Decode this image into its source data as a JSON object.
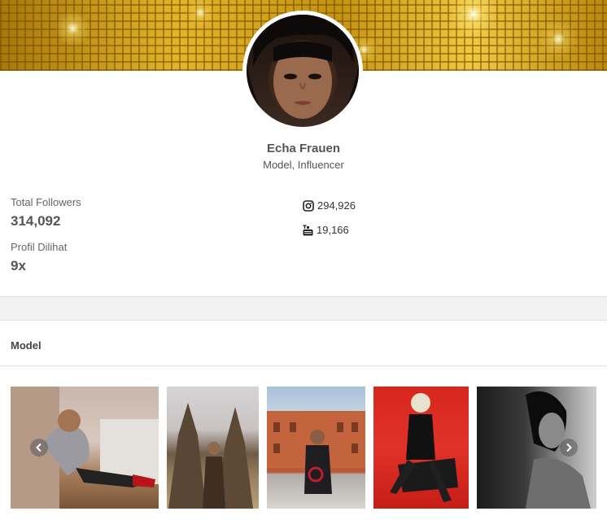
{
  "profile": {
    "name": "Echa Frauen",
    "subtitle": "Model, Influencer"
  },
  "stats": {
    "total_followers_label": "Total Followers",
    "total_followers_value": "314,092",
    "profile_views_label": "Profil Dilihat",
    "profile_views_value": "9x"
  },
  "social": {
    "instagram_icon": "instagram-icon",
    "instagram_count": "294,926",
    "youtube_icon": "youtube-icon",
    "youtube_count": "19,166"
  },
  "section": {
    "title": "Model"
  },
  "gallery": {
    "prev_icon": "arrow-left-icon",
    "next_icon": "arrow-right-icon"
  },
  "colors": {
    "banner_gold": "#c3920f",
    "text": "#555555",
    "divider": "#e2e2e2"
  }
}
